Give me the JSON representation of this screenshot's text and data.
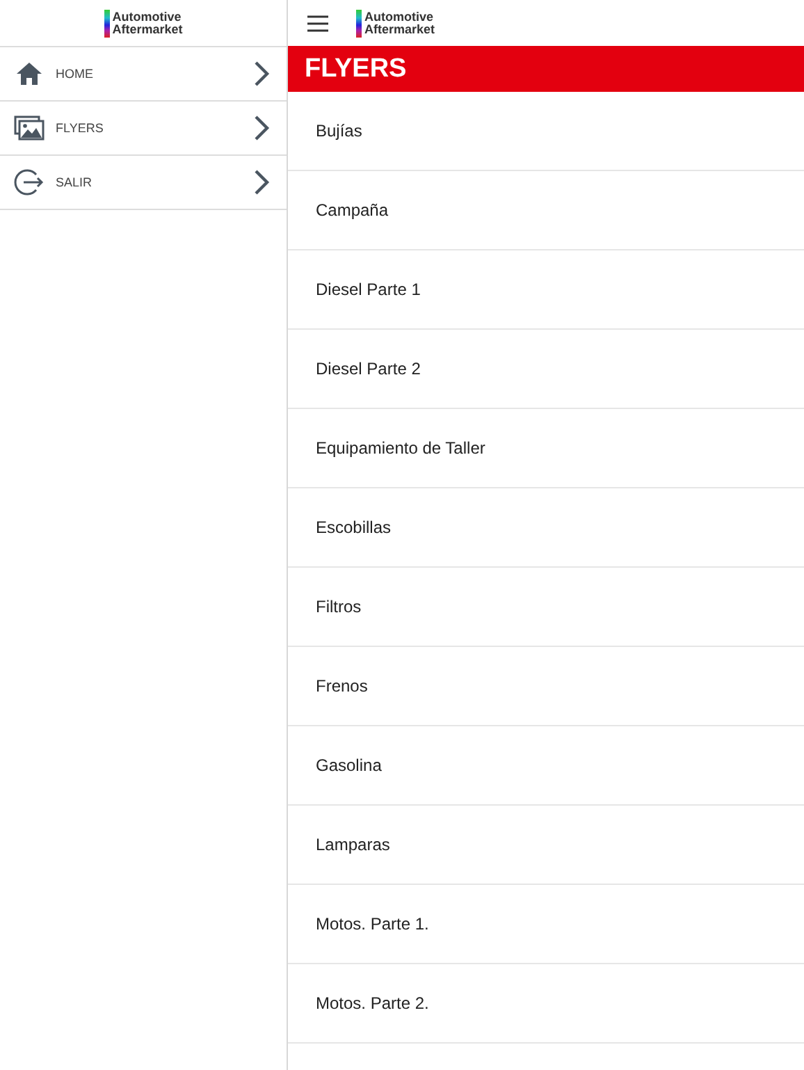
{
  "sidebar": {
    "logo": {
      "lines": [
        "Automotive",
        "Aftermarket"
      ]
    },
    "items": [
      {
        "kind": "home",
        "label": "HOME"
      },
      {
        "kind": "gallery",
        "label": "FLYERS"
      },
      {
        "kind": "exit",
        "label": "SALIR"
      }
    ]
  },
  "main": {
    "logo": {
      "lines": [
        "Automotive",
        "Aftermarket"
      ]
    },
    "title": "FLYERS",
    "items": [
      "Bujías",
      "Campaña",
      "Diesel Parte 1",
      "Diesel Parte 2",
      "Equipamiento de Taller",
      "Escobillas",
      "Filtros",
      "Frenos",
      "Gasolina",
      "Lamparas",
      "Motos. Parte 1.",
      "Motos. Parte 2."
    ]
  }
}
